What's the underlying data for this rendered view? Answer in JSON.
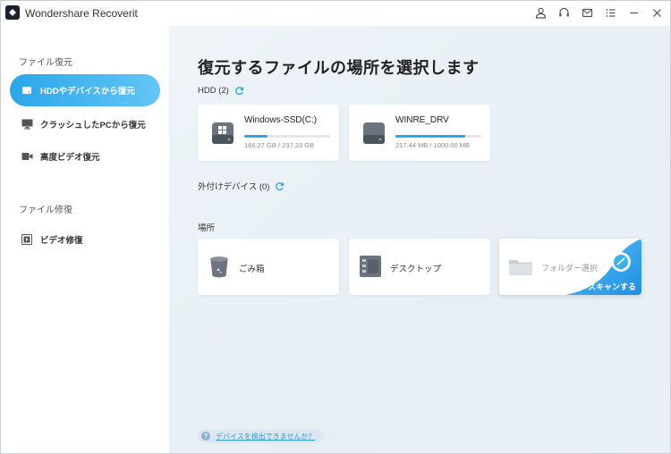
{
  "app": {
    "title": "Wondershare Recoverit"
  },
  "sidebar": {
    "section1_title": "ファイル復元",
    "items": [
      {
        "label": "HDDやデバイスから復元",
        "icon": "hdd-icon",
        "active": true
      },
      {
        "label": "クラッシュしたPCから復元",
        "icon": "monitor-icon"
      },
      {
        "label": "高度ビデオ復元",
        "icon": "video-camera-icon"
      }
    ],
    "section2_title": "ファイル修復",
    "repair_items": [
      {
        "label": "ビデオ修復",
        "icon": "video-repair-icon"
      }
    ]
  },
  "main": {
    "title": "復元するファイルの場所を選択します",
    "hdd_label": "HDD (2)",
    "drives": [
      {
        "name": "Windows-SSD(C:)",
        "size": "166.27 GB / 237.23 GB",
        "usage": 0.27
      },
      {
        "name": "WINRE_DRV",
        "size": "217.44 MB / 1000.00 MB",
        "usage": 0.81
      }
    ],
    "external_label": "外付けデバイス (0)",
    "locations_label": "場所",
    "locations": [
      {
        "label": "ごみ箱",
        "icon": "recycle-bin-icon"
      },
      {
        "label": "デスクトップ",
        "icon": "desktop-icon"
      }
    ],
    "folder_select": {
      "label": "フォルダー選択",
      "scan_label": "スキャンする"
    },
    "help_link": "デバイスを検出できませんか？"
  },
  "colors": {
    "accent": "#2aa6ea",
    "sidebar_bg": "#ffffff",
    "main_bg": "#eaf1f6"
  }
}
